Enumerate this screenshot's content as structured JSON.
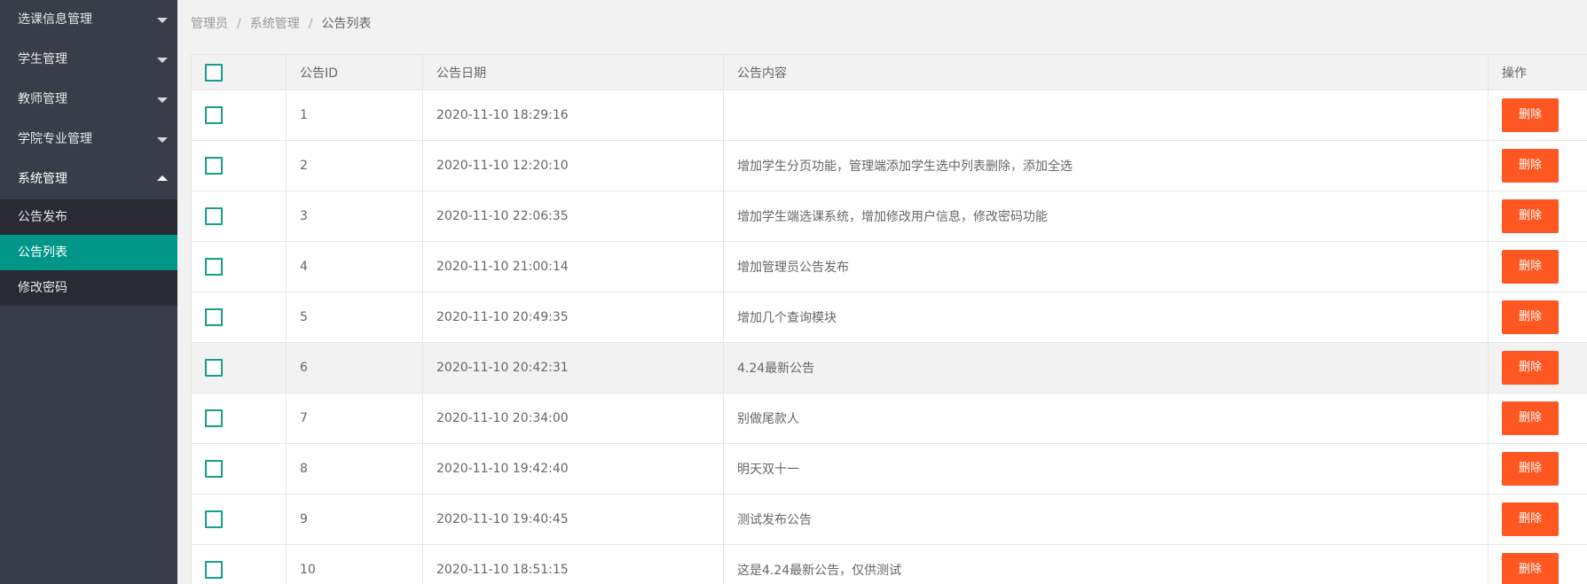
{
  "sidebar": {
    "groups": [
      {
        "label": "选课信息管理",
        "expanded": false
      },
      {
        "label": "学生管理",
        "expanded": false
      },
      {
        "label": "教师管理",
        "expanded": false
      },
      {
        "label": "学院专业管理",
        "expanded": false
      },
      {
        "label": "系统管理",
        "expanded": true
      }
    ],
    "subitems": [
      {
        "label": "公告发布",
        "active": false
      },
      {
        "label": "公告列表",
        "active": true
      },
      {
        "label": "修改密码",
        "active": false
      }
    ]
  },
  "breadcrumb": {
    "items": [
      "管理员",
      "系统管理",
      "公告列表"
    ],
    "separator": "/"
  },
  "table": {
    "headers": {
      "id": "公告ID",
      "date": "公告日期",
      "content": "公告内容",
      "action": "操作"
    },
    "delete_label": "删除",
    "rows": [
      {
        "id": "1",
        "date": "2020-11-10 18:29:16",
        "content": ""
      },
      {
        "id": "2",
        "date": "2020-11-10 12:20:10",
        "content": "增加学生分页功能，管理端添加学生选中列表删除，添加全选"
      },
      {
        "id": "3",
        "date": "2020-11-10 22:06:35",
        "content": "增加学生端选课系统，增加修改用户信息，修改密码功能"
      },
      {
        "id": "4",
        "date": "2020-11-10 21:00:14",
        "content": "增加管理员公告发布"
      },
      {
        "id": "5",
        "date": "2020-11-10 20:49:35",
        "content": "增加几个查询模块"
      },
      {
        "id": "6",
        "date": "2020-11-10 20:42:31",
        "content": "4.24最新公告"
      },
      {
        "id": "7",
        "date": "2020-11-10 20:34:00",
        "content": "别做尾款人"
      },
      {
        "id": "8",
        "date": "2020-11-10 19:42:40",
        "content": "明天双十一"
      },
      {
        "id": "9",
        "date": "2020-11-10 19:40:45",
        "content": "测试发布公告"
      },
      {
        "id": "10",
        "date": "2020-11-10 18:51:15",
        "content": "这是4.24最新公告，仅供测试"
      }
    ]
  },
  "colors": {
    "sidebar_bg": "#393d49",
    "subnav_bg": "#282b33",
    "active": "#009688",
    "delete_button": "#ff5722",
    "checkbox_border": "#14a085"
  },
  "icons": {
    "collapsed": "caret-down-icon",
    "expanded": "caret-up-icon"
  }
}
